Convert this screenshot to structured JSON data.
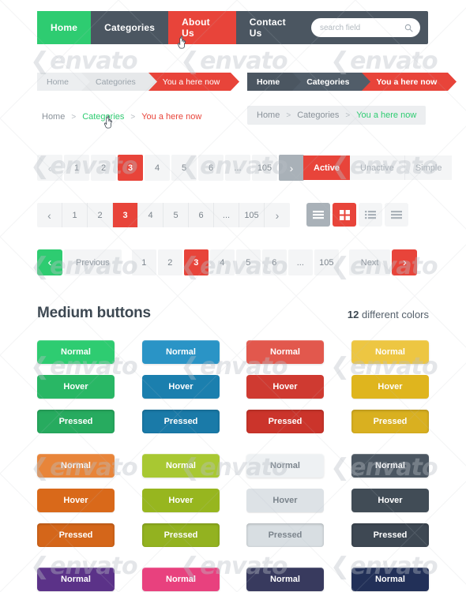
{
  "topnav": {
    "items": [
      {
        "label": "Home",
        "state": "active-green"
      },
      {
        "label": "Categories",
        "state": "default"
      },
      {
        "label": "About Us",
        "state": "hover-red"
      },
      {
        "label": "Contact Us",
        "state": "default"
      }
    ],
    "search": {
      "value": "",
      "placeholder": "search field",
      "icon": "search-icon"
    },
    "colors": {
      "bar": "#4b5661",
      "green": "#2ecc71",
      "red": "#e8443a"
    }
  },
  "breadcrumbs": {
    "arrow_light": [
      "Home",
      "Categories",
      "You a here now"
    ],
    "arrow_dark": [
      "Home",
      "Categories",
      "You a here now"
    ],
    "text_plain": {
      "items": [
        "Home",
        "Categories",
        "You a here now"
      ],
      "separator": ">"
    },
    "text_boxed": {
      "items": [
        "Home",
        "Categories",
        "You a here now"
      ],
      "separator": ">"
    }
  },
  "pagination": {
    "simple": {
      "prev": "‹",
      "next": "›",
      "pages": [
        "1",
        "2",
        "3",
        "4",
        "5",
        "6",
        "...",
        "105"
      ],
      "active": "3"
    },
    "bordered": {
      "prev": "‹",
      "next": "›",
      "pages": [
        "1",
        "2",
        "3",
        "4",
        "5",
        "6",
        "...",
        "105"
      ],
      "active": "3"
    },
    "large": {
      "prev_label": "Previous",
      "next_label": "Next",
      "prev_arrow": "‹",
      "next_arrow": "›",
      "pages": [
        "1",
        "2",
        "3",
        "4",
        "5",
        "6",
        "...",
        "105"
      ],
      "active": "3"
    }
  },
  "segmented_tabs": [
    {
      "label": "Active",
      "state": "active"
    },
    {
      "label": "Unactive",
      "state": "default"
    },
    {
      "label": "Simple",
      "state": "default"
    }
  ],
  "view_toggles": [
    {
      "icon": "hamburger-menu-icon",
      "state": "grey"
    },
    {
      "icon": "grid-view-icon",
      "state": "red"
    },
    {
      "icon": "list-view-icon",
      "state": "default"
    },
    {
      "icon": "lines-view-icon",
      "state": "default"
    }
  ],
  "buttons_section": {
    "title": "Medium buttons",
    "count": "12",
    "count_suffix": " different colors",
    "states": [
      "Normal",
      "Hover",
      "Pressed"
    ],
    "columns": [
      {
        "name": "green",
        "normal": "#2ecc71",
        "hover": "#29b765",
        "pressed": "#27ab5f",
        "text": "#ffffff"
      },
      {
        "name": "blue",
        "normal": "#2a94c6",
        "hover": "#1b7fae",
        "pressed": "#1a7aa8",
        "text": "#ffffff"
      },
      {
        "name": "red",
        "normal": "#e2584d",
        "hover": "#cf3a31",
        "pressed": "#cb342b",
        "text": "#ffffff"
      },
      {
        "name": "yellow",
        "normal": "#edc642",
        "hover": "#dfb51e",
        "pressed": "#d9b020",
        "text": "#ffffff"
      },
      {
        "name": "orange",
        "normal": "#e8853a",
        "hover": "#d9691a",
        "pressed": "#d4661a",
        "text": "#ffffff"
      },
      {
        "name": "olive",
        "normal": "#a8c832",
        "hover": "#97b61f",
        "pressed": "#93b220",
        "text": "#ffffff"
      },
      {
        "name": "light",
        "normal": "#eef1f3",
        "hover": "#dde2e6",
        "pressed": "#d8dee2",
        "text": "#7b848c"
      },
      {
        "name": "slate",
        "normal": "#4b5661",
        "hover": "#414c56",
        "pressed": "#3e4853",
        "text": "#ffffff"
      },
      {
        "name": "purple",
        "normal": "#5b3288",
        "hover": "#4e2a76",
        "pressed": "#4a2771",
        "text": "#ffffff"
      },
      {
        "name": "pink",
        "normal": "#e8417e",
        "hover": "#d62f6c",
        "pressed": "#d02a67",
        "text": "#ffffff"
      },
      {
        "name": "indigo",
        "normal": "#383a5e",
        "hover": "#2f3152",
        "pressed": "#2c2e4e",
        "text": "#ffffff"
      },
      {
        "name": "navy",
        "normal": "#223058",
        "hover": "#1b274b",
        "pressed": "#192447",
        "text": "#ffffff"
      }
    ]
  },
  "watermark": {
    "text": "envato"
  }
}
